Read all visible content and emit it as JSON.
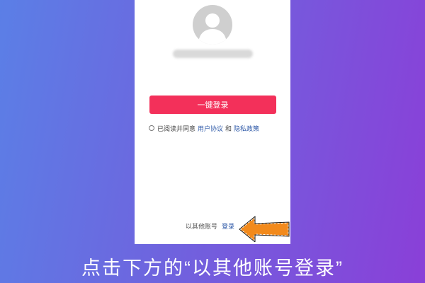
{
  "screen": {
    "profile": {
      "avatar_icon": "user-avatar-icon"
    },
    "primary_button": {
      "label": "一键登录",
      "color": "#f3305a"
    },
    "agreement": {
      "prefix": "已阅读并同意",
      "terms_link": "用户协议",
      "conjunction": "和",
      "privacy_link": "隐私政策"
    },
    "other_login": {
      "text": "以其他账号",
      "link": "登录"
    }
  },
  "annotation": {
    "arrow_icon": "pointer-arrow-icon",
    "caption": "点击下方的“以其他账号登录”"
  }
}
